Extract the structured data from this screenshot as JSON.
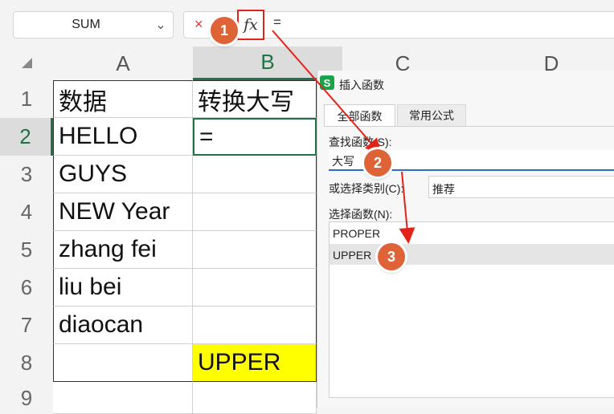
{
  "formula_bar": {
    "name_box": "SUM",
    "cancel_icon": "×",
    "fx_label": "fx",
    "formula_text": "="
  },
  "grid": {
    "columns": [
      "A",
      "B",
      "C",
      "D"
    ],
    "rows": [
      "1",
      "2",
      "3",
      "4",
      "5",
      "6",
      "7",
      "8",
      "9"
    ],
    "cells_a": [
      "数据",
      "HELLO",
      "GUYS",
      "NEW Year",
      "zhang fei",
      "liu bei",
      "diaocan",
      ""
    ],
    "cells_b": [
      "转换大写",
      "=",
      "",
      "",
      "",
      "",
      "",
      "UPPER"
    ]
  },
  "dialog": {
    "app_icon_letter": "S",
    "title": "插入函数",
    "tabs": [
      "全部函数",
      "常用公式"
    ],
    "search_label": "查找函数(S):",
    "search_value": "大写",
    "category_label": "或选择类别(C):",
    "category_value": "推荐",
    "function_list_label": "选择函数(N):",
    "functions": [
      "PROPER",
      "UPPER"
    ]
  },
  "callouts": [
    "1",
    "2",
    "3"
  ],
  "colors": {
    "accent_red": "#e2231a",
    "callout_orange": "#de6438",
    "highlight_yellow": "#ffff00",
    "active_cell_green": "#217346"
  }
}
